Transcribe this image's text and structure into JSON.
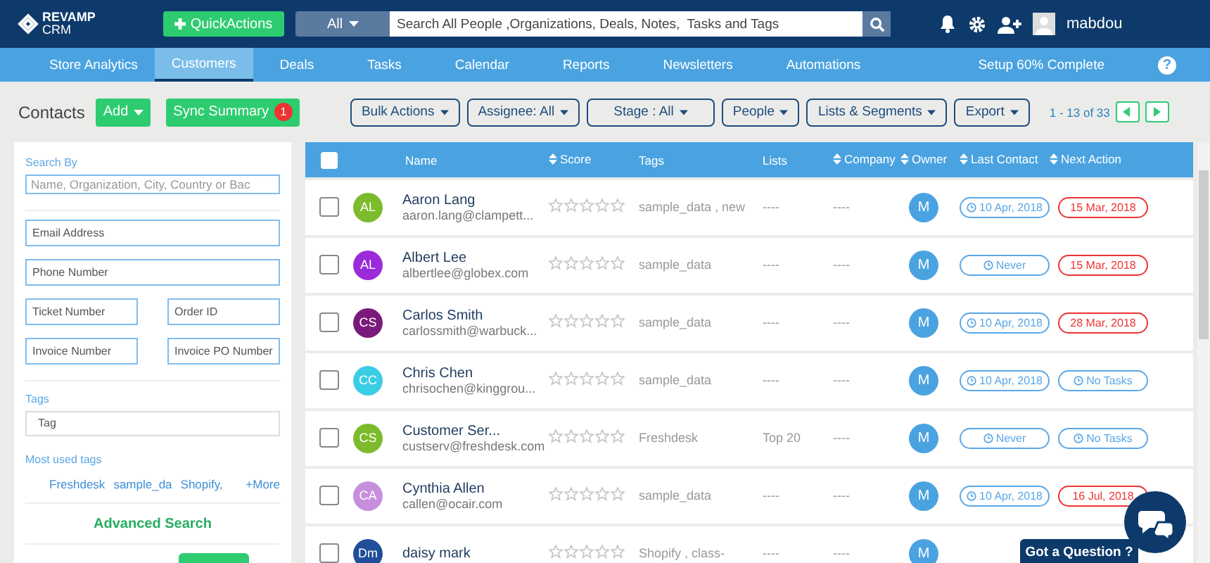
{
  "topbar": {
    "logo": "REVAMP",
    "logo_sub": "CRM",
    "quick_actions": "QuickActions",
    "search_scope": "All",
    "search_placeholder": "Search All People ,Organizations, Deals, Notes,  Tasks and Tags",
    "username": "mabdou"
  },
  "nav": {
    "items": [
      {
        "label": "Store Analytics",
        "selected": false
      },
      {
        "label": "Customers",
        "selected": true
      },
      {
        "label": "Deals",
        "selected": false
      },
      {
        "label": "Tasks",
        "selected": false
      },
      {
        "label": "Calendar",
        "selected": false
      },
      {
        "label": "Reports",
        "selected": false
      },
      {
        "label": "Newsletters",
        "selected": false
      },
      {
        "label": "Automations",
        "selected": false
      }
    ],
    "setup": "Setup 60% Complete",
    "help": "?"
  },
  "toolbar": {
    "title": "Contacts",
    "add": "Add",
    "sync": "Sync Summary",
    "sync_count": "1",
    "filters": [
      "Bulk Actions",
      "Assignee: All",
      "Stage : All",
      "People",
      "Lists & Segments",
      "Export"
    ],
    "pager": "1 - 13 of 33"
  },
  "search_panel": {
    "search_by": "Search By",
    "name_placeholder": "Name, Organization, City, Country or Bac",
    "fields": [
      [
        {
          "placeholder": "Email Address"
        }
      ],
      [
        {
          "placeholder": "Phone Number"
        }
      ],
      [
        {
          "placeholder": "Ticket Number"
        },
        {
          "placeholder": "Order ID"
        }
      ],
      [
        {
          "placeholder": "Invoice Number"
        },
        {
          "placeholder": "Invoice PO Number"
        }
      ]
    ],
    "tags_label": "Tags",
    "tag_placeholder": "Tag",
    "most_used": "Most used tags",
    "used_tags": [
      "Freshdesk",
      "sample_da",
      "Shopify,"
    ],
    "more": "+More",
    "advanced": "Advanced Search"
  },
  "table": {
    "select_all": false,
    "columns": [
      {
        "label": "Name",
        "sortable": false
      },
      {
        "label": "Score",
        "sortable": true
      },
      {
        "label": "Tags",
        "sortable": false
      },
      {
        "label": "Lists",
        "sortable": false
      },
      {
        "label": "Company",
        "sortable": true
      },
      {
        "label": "Owner",
        "sortable": true
      },
      {
        "label": "Last Contact",
        "sortable": true
      },
      {
        "label": "Next Action",
        "sortable": true
      }
    ],
    "rows": [
      {
        "checked": false,
        "initials": "AL",
        "color": "#7cbb2c",
        "name": "Aaron Lang",
        "email": "aaron.lang@clampett...",
        "stars": 0,
        "tags": "sample_data , new",
        "lists": "----",
        "company": "----",
        "owner": "M",
        "last_contact": "10 Apr, 2018",
        "next_action": "15 Mar, 2018",
        "overdue": true
      },
      {
        "checked": false,
        "initials": "AL",
        "color": "#9b2bd8",
        "name": "Albert Lee",
        "email": "albertlee@globex.com",
        "stars": 0,
        "tags": "sample_data",
        "lists": "----",
        "company": "----",
        "owner": "M",
        "last_contact": "Never",
        "next_action": "15 Mar, 2018",
        "overdue": true
      },
      {
        "checked": false,
        "initials": "CS",
        "color": "#7a1a7a",
        "name": "Carlos Smith",
        "email": "carlossmith@warbuck...",
        "stars": 0,
        "tags": "sample_data",
        "lists": "----",
        "company": "----",
        "owner": "M",
        "last_contact": "10 Apr, 2018",
        "next_action": "28 Mar, 2018",
        "overdue": true
      },
      {
        "checked": false,
        "initials": "CC",
        "color": "#3ccde6",
        "name": "Chris Chen",
        "email": "chrisochen@kinggrou...",
        "stars": 0,
        "tags": "sample_data",
        "lists": "----",
        "company": "----",
        "owner": "M",
        "last_contact": "10 Apr, 2018",
        "next_action": "No Tasks",
        "overdue": false
      },
      {
        "checked": false,
        "initials": "CS",
        "color": "#7cbb2c",
        "name": "Customer Ser...",
        "email": "custserv@freshdesk.com",
        "stars": 0,
        "tags": "Freshdesk",
        "lists": "Top 20",
        "company": "----",
        "owner": "M",
        "last_contact": "Never",
        "next_action": "No Tasks",
        "overdue": false
      },
      {
        "checked": false,
        "initials": "CA",
        "color": "#c58fdd",
        "name": "Cynthia Allen",
        "email": "callen@ocair.com",
        "stars": 0,
        "tags": "sample_data",
        "lists": "----",
        "company": "----",
        "owner": "M",
        "last_contact": "10 Apr, 2018",
        "next_action": "16 Jul, 2018",
        "overdue": true
      },
      {
        "checked": false,
        "initials": "Dm",
        "color": "#1f4e9a",
        "name": "daisy mark",
        "stars": 0,
        "tags": "Shopify , class-",
        "lists": "----",
        "company": "----",
        "owner": "M"
      }
    ]
  },
  "chat": {
    "question": "Got a Question ?"
  }
}
